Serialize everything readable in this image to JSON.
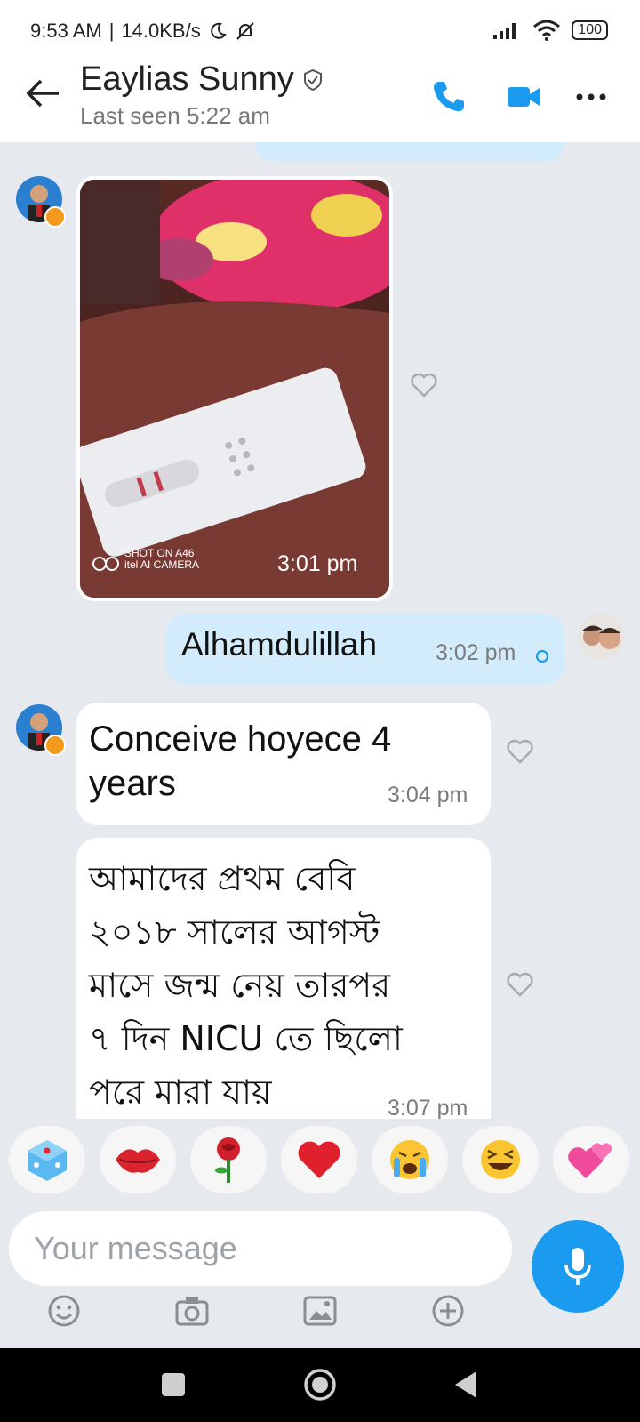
{
  "status_bar": {
    "time": "9:53 AM",
    "separator": "|",
    "speed": "14.0KB/s",
    "battery": "100"
  },
  "header": {
    "contact_name": "Eaylias Sunny",
    "last_seen": "Last seen 5:22 am"
  },
  "messages": [
    {
      "id": "photo",
      "direction": "in",
      "image_caption_line1": "SHOT ON A46",
      "image_caption_line2": "itel AI CAMERA",
      "time": "3:01 pm"
    },
    {
      "id": "m1",
      "direction": "out",
      "text": "Alhamdulillah",
      "time": "3:02 pm"
    },
    {
      "id": "m2",
      "direction": "in",
      "text_line1": "Conceive hoyece 4",
      "text_line2": "years",
      "time": "3:04 pm"
    },
    {
      "id": "m3",
      "direction": "in",
      "lines": [
        "আমাদের প্রথম বেবি",
        "২০১৮ সালের আগস্ট",
        "মাসে জন্ম নেয় তারপর",
        "৭ দিন NICU তে ছিলো",
        "পরে মারা যায়"
      ],
      "time": "3:07 pm"
    }
  ],
  "composer": {
    "placeholder": "Your message"
  },
  "reactions": [
    "dice",
    "lips",
    "rose",
    "heart",
    "crying-face",
    "laughing-face",
    "two-hearts"
  ],
  "colors": {
    "accent": "#1a9bf0",
    "outgoing_bubble": "#d3ecfb",
    "incoming_bubble": "#ffffff",
    "background": "#e6e9ed"
  }
}
